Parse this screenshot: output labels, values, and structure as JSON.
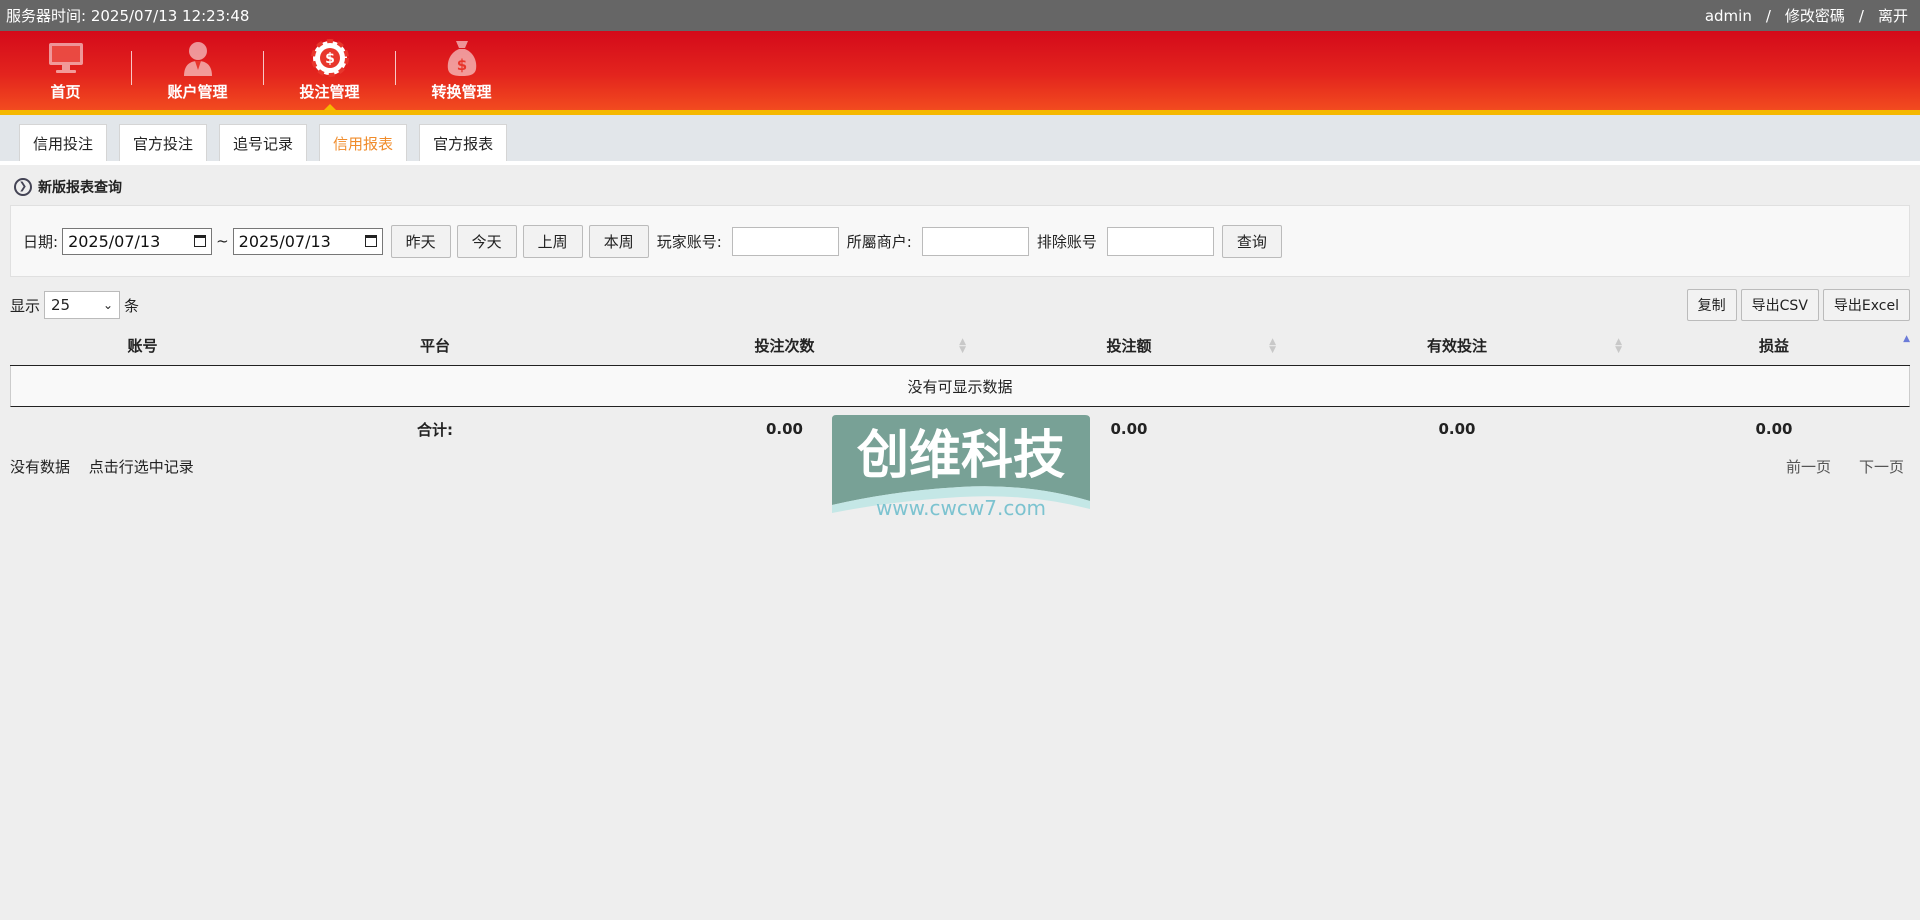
{
  "topbar": {
    "server_time": "服务器时间:  2025/07/13 12:23:48",
    "user": "admin",
    "sep": "/",
    "change_password": "修改密碼",
    "logout": "离开"
  },
  "nav": [
    {
      "label": "首页",
      "icon": "monitor-icon"
    },
    {
      "label": "账户管理",
      "icon": "user-icon"
    },
    {
      "label": "投注管理",
      "icon": "casino-chip-icon"
    },
    {
      "label": "转换管理",
      "icon": "money-bag-icon"
    }
  ],
  "tabs": [
    {
      "label": "信用投注"
    },
    {
      "label": "官方投注"
    },
    {
      "label": "追号记录"
    },
    {
      "label": "信用报表",
      "active": true
    },
    {
      "label": "官方报表"
    }
  ],
  "section_title": "新版报表查询",
  "filter": {
    "date_label": "日期:",
    "date_from": "2025/07/13",
    "tilde": "~",
    "date_to": "2025/07/13",
    "btn_yesterday": "昨天",
    "btn_today": "今天",
    "btn_last_week": "上周",
    "btn_this_week": "本周",
    "player_label": "玩家账号:",
    "merchant_label": "所屬商户:",
    "exclude_label": "排除账号",
    "btn_query": "查询"
  },
  "toolbar": {
    "show_label": "显示",
    "page_size": "25",
    "rows_unit": "条",
    "btn_copy": "复制",
    "btn_csv": "导出CSV",
    "btn_excel": "导出Excel"
  },
  "table": {
    "headers": [
      "账号",
      "平台",
      "投注次数",
      "投注额",
      "有效投注",
      "损益"
    ],
    "empty_text": "没有可显示数据",
    "footer": [
      "",
      "合计:",
      "0.00",
      "0.00",
      "0.00",
      "0.00"
    ]
  },
  "bottom": {
    "no_data": "没有数据",
    "hint": "点击行选中记录",
    "prev": "前一页",
    "next": "下一页"
  },
  "watermark": {
    "title": "创维科技",
    "url": "www.cwcw7.com"
  },
  "colors": {
    "header_red": "#d40a1a",
    "header_accent": "#f5b800",
    "active_tab": "#f08c2b"
  }
}
